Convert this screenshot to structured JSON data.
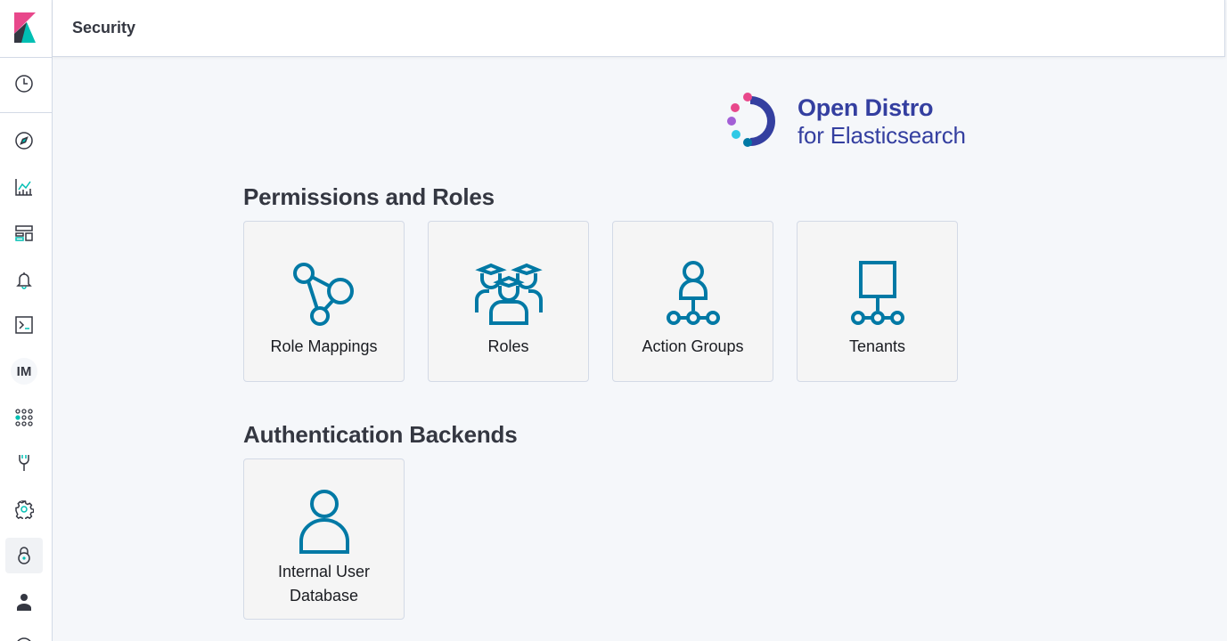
{
  "header": {
    "title": "Security"
  },
  "brand": {
    "line1": "Open Distro",
    "line2": "for Elasticsearch"
  },
  "sidebar": {
    "items": [
      {
        "name": "recently-viewed-icon"
      },
      {
        "name": "discover-icon"
      },
      {
        "name": "visualize-icon"
      },
      {
        "name": "dashboard-icon"
      },
      {
        "name": "alerting-icon"
      },
      {
        "name": "dev-tools-icon"
      },
      {
        "name": "index-management-badge",
        "label": "IM"
      },
      {
        "name": "apps-icon"
      },
      {
        "name": "plugin-icon"
      },
      {
        "name": "management-icon"
      },
      {
        "name": "security-icon",
        "active": true
      },
      {
        "name": "user-icon"
      }
    ]
  },
  "sections": {
    "permissions": {
      "title": "Permissions and Roles",
      "cards": [
        {
          "label": "Role Mappings",
          "icon": "role-mappings-icon"
        },
        {
          "label": "Roles",
          "icon": "roles-icon"
        },
        {
          "label": "Action Groups",
          "icon": "action-groups-icon"
        },
        {
          "label": "Tenants",
          "icon": "tenants-icon"
        }
      ]
    },
    "authentication": {
      "title": "Authentication Backends",
      "cards": [
        {
          "label_line1": "Internal User",
          "label_line2": "Database",
          "icon": "internal-user-icon"
        }
      ]
    }
  },
  "colors": {
    "accent": "#0079a5",
    "brand": "#343fa0",
    "kibana_pink": "#e8488b",
    "kibana_teal": "#00bfb3"
  }
}
